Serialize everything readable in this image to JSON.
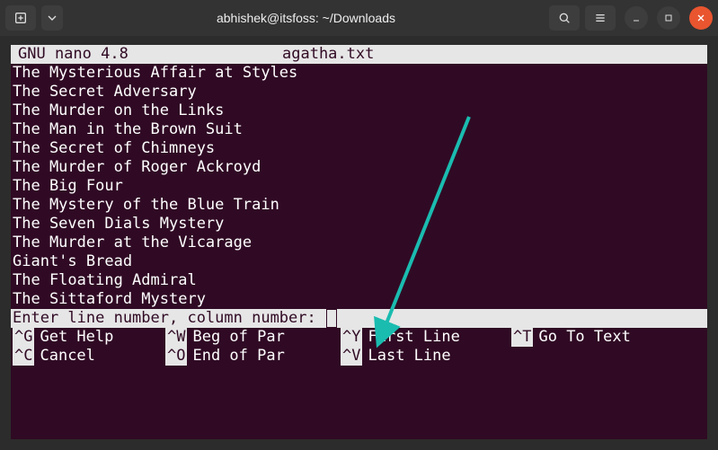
{
  "window": {
    "title": "abhishek@itsfoss: ~/Downloads"
  },
  "nano": {
    "header_version": "  GNU nano 4.8",
    "header_filename": "agatha.txt",
    "lines": [
      "The Mysterious Affair at Styles",
      "The Secret Adversary",
      "The Murder on the Links",
      "The Man in the Brown Suit",
      "The Secret of Chimneys",
      "The Murder of Roger Ackroyd",
      "The Big Four",
      "The Mystery of the Blue Train",
      "The Seven Dials Mystery",
      "The Murder at the Vicarage",
      "Giant's Bread",
      "The Floating Admiral",
      "The Sittaford Mystery"
    ],
    "prompt": "Enter line number, column number: ",
    "shortcuts_row1": [
      {
        "key": "^G",
        "label": "Get Help"
      },
      {
        "key": "^W",
        "label": "Beg of Par"
      },
      {
        "key": "^Y",
        "label": "First Line"
      },
      {
        "key": "^T",
        "label": "Go To Text"
      }
    ],
    "shortcuts_row2": [
      {
        "key": "^C",
        "label": "Cancel"
      },
      {
        "key": "^O",
        "label": "End of Par"
      },
      {
        "key": "^V",
        "label": "Last Line"
      }
    ]
  },
  "colors": {
    "terminal_bg": "#300a24",
    "highlight_bg": "#e6e6e6",
    "arrow": "#1abcb0"
  }
}
